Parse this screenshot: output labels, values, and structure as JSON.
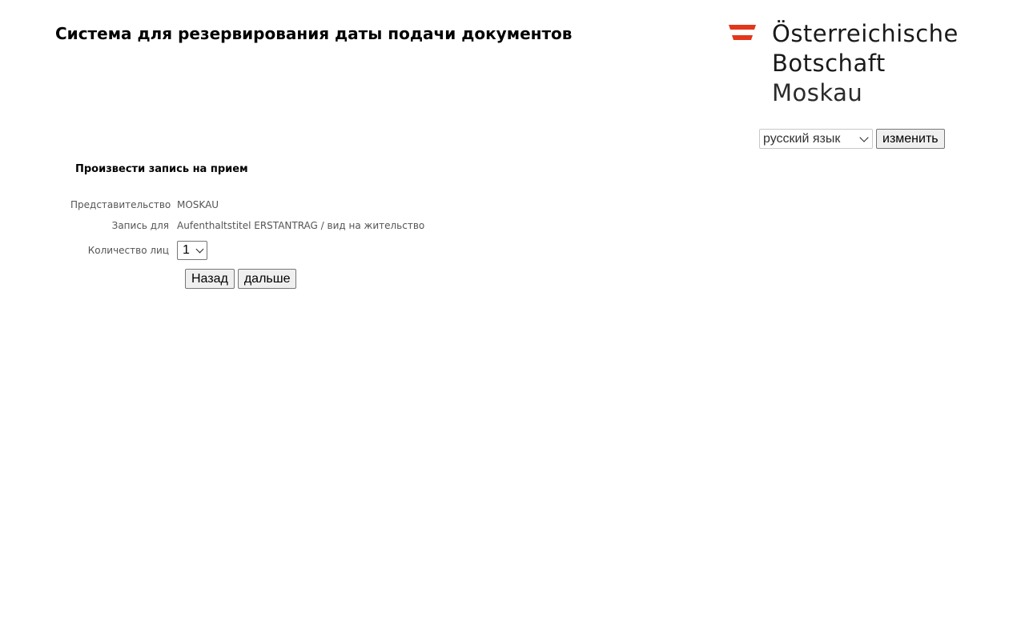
{
  "header": {
    "title": "Система для резервирования даты подачи документов"
  },
  "logo": {
    "line1": "Österreichische",
    "line2": "Botschaft",
    "line3": "Moskau",
    "flag_colors": [
      "#e3361b",
      "#ffffff",
      "#e3361b"
    ]
  },
  "language": {
    "selected": "русский язык",
    "change_button": "изменить"
  },
  "form": {
    "title": "Произвести запись на прием",
    "fields": [
      {
        "label": "Представительство",
        "value": "MOSKAU"
      },
      {
        "label": "Запись для",
        "value": "Aufenthaltstitel ERSTANTRAG / вид на жительство"
      },
      {
        "label": "Количество лиц",
        "value": "1"
      }
    ],
    "back_button": "Назад",
    "next_button": "дальше"
  }
}
